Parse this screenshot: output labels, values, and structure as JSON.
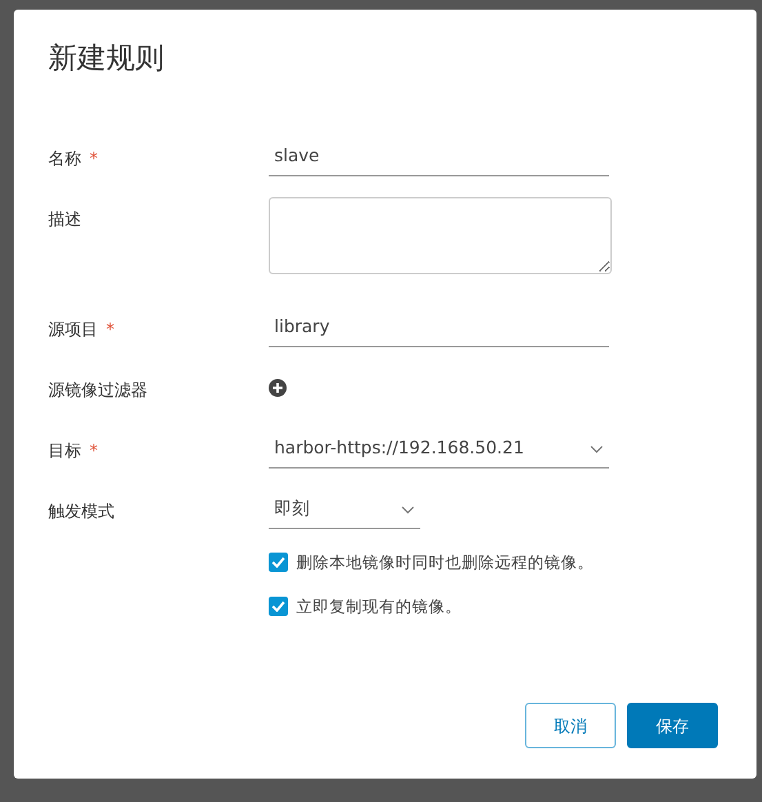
{
  "dialog": {
    "title": "新建规则"
  },
  "fields": [
    {
      "kind": "text",
      "label": "名称",
      "required_mark": "*",
      "value": "slave"
    },
    {
      "kind": "textarea",
      "label": "描述"
    },
    {
      "kind": "text",
      "label": "源项目",
      "required_mark": "*",
      "value": "library"
    },
    {
      "kind": "add",
      "label": "源镜像过滤器"
    },
    {
      "kind": "select",
      "label": "目标",
      "required_mark": "*",
      "value": "harbor-https://192.168.50.21"
    },
    {
      "kind": "select-small",
      "label": "触发模式",
      "value": "即刻"
    }
  ],
  "options": [
    {
      "label": "删除本地镜像时同时也删除远程的镜像。",
      "checked": true
    },
    {
      "label": "立即复制现有的镜像。",
      "checked": true
    }
  ],
  "buttons": [
    {
      "label": "取消",
      "kind": "secondary"
    },
    {
      "label": "保存",
      "kind": "primary"
    }
  ]
}
